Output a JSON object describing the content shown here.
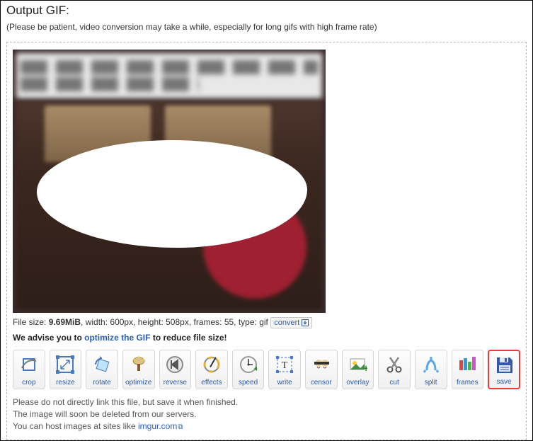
{
  "heading": "Output GIF:",
  "patient_note": "(Please be patient, video conversion may take a while, especially for long gifs with high frame rate)",
  "file_meta": {
    "prefix": "File size: ",
    "size": "9.69MiB",
    "rest": ", width: 600px, height: 508px, frames: 55, type: gif",
    "convert_label": "convert"
  },
  "advice": {
    "before": "We advise you to ",
    "link": "optimize the GIF",
    "after": " to reduce file size!"
  },
  "toolbar": [
    {
      "id": "crop",
      "label": "crop"
    },
    {
      "id": "resize",
      "label": "resize"
    },
    {
      "id": "rotate",
      "label": "rotate"
    },
    {
      "id": "optimize",
      "label": "optimize"
    },
    {
      "id": "reverse",
      "label": "reverse"
    },
    {
      "id": "effects",
      "label": "effects"
    },
    {
      "id": "speed",
      "label": "speed"
    },
    {
      "id": "write",
      "label": "write"
    },
    {
      "id": "censor",
      "label": "censor"
    },
    {
      "id": "overlay",
      "label": "overlay"
    },
    {
      "id": "cut",
      "label": "cut"
    },
    {
      "id": "split",
      "label": "split"
    },
    {
      "id": "frames",
      "label": "frames"
    },
    {
      "id": "save",
      "label": "save"
    }
  ],
  "footer": {
    "line1": "Please do not directly link this file, but save it when finished.",
    "line2": "The image will soon be deleted from our servers.",
    "line3_before": "You can host images at sites like ",
    "line3_link": "imgur.com"
  }
}
